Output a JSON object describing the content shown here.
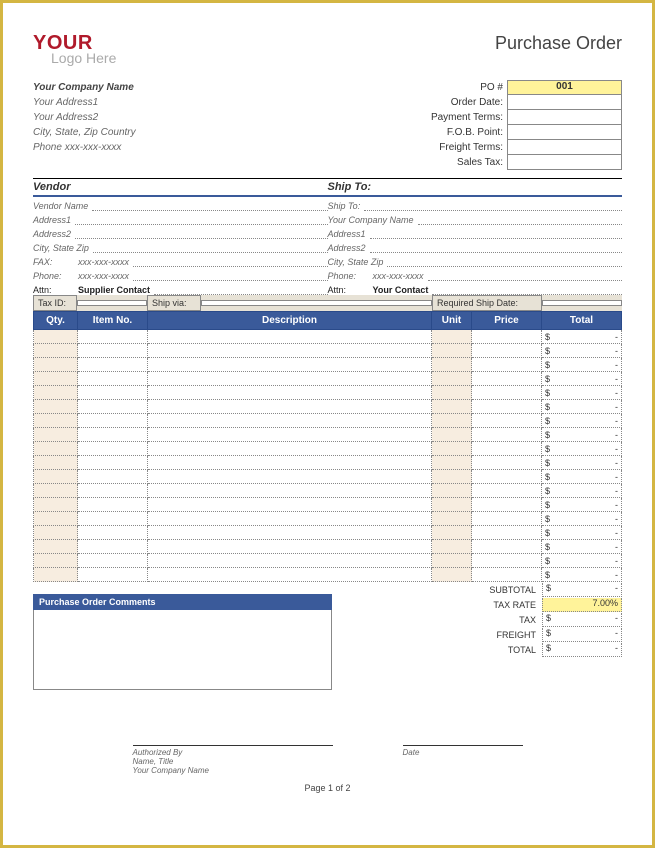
{
  "logo": {
    "line1": "YOUR",
    "line2": "Logo Here"
  },
  "title": "Purchase Order",
  "company": {
    "name": "Your Company Name",
    "addr1": "Your Address1",
    "addr2": "Your Address2",
    "csz": "City, State, Zip Country",
    "phone": "Phone xxx-xxx-xxxx"
  },
  "po_fields": {
    "po_num_label": "PO #",
    "po_num": "001",
    "order_date_label": "Order Date:",
    "order_date": "",
    "pay_terms_label": "Payment Terms:",
    "pay_terms": "",
    "fob_label": "F.O.B. Point:",
    "fob": "",
    "freight_label": "Freight Terms:",
    "freight": "",
    "salestax_label": "Sales Tax:",
    "salestax": ""
  },
  "vendor": {
    "header": "Vendor",
    "name": "Vendor Name",
    "addr1": "Address1",
    "addr2": "Address2",
    "csz": "City, State Zip",
    "fax_l": "FAX:",
    "fax": "xxx-xxx-xxxx",
    "phone_l": "Phone:",
    "phone": "xxx-xxx-xxxx",
    "attn_l": "Attn:",
    "attn": "Supplier Contact"
  },
  "shipto": {
    "header": "Ship To:",
    "line0": "Ship To:",
    "name": "Your Company Name",
    "addr1": "Address1",
    "addr2": "Address2",
    "csz": "City, State Zip",
    "phone_l": "Phone:",
    "phone": "xxx-xxx-xxxx",
    "attn_l": "Attn:",
    "attn": "Your Contact"
  },
  "midbar": {
    "taxid_l": "Tax ID:",
    "taxid": "",
    "shipvia_l": "Ship via:",
    "shipvia": "",
    "reqdate_l": "Required Ship Date:",
    "reqdate": ""
  },
  "columns": {
    "qty": "Qty.",
    "item": "Item No.",
    "desc": "Description",
    "unit": "Unit",
    "price": "Price",
    "total": "Total"
  },
  "rows": 18,
  "row_total_prefix": "$",
  "row_total_value": "-",
  "totals": {
    "subtotal_l": "SUBTOTAL",
    "subtotal_d": "$",
    "subtotal_v": "-",
    "taxrate_l": "TAX RATE",
    "taxrate_v": "7.00%",
    "tax_l": "TAX",
    "tax_d": "$",
    "tax_v": "-",
    "freight_l": "FREIGHT",
    "freight_d": "$",
    "freight_v": "-",
    "total_l": "TOTAL",
    "total_d": "$",
    "total_v": "-"
  },
  "comments_header": "Purchase Order Comments",
  "signature": {
    "auth": "Authorized By",
    "name": "Name, Title",
    "company": "Your Company Name",
    "date": "Date"
  },
  "pager": "Page 1 of 2"
}
